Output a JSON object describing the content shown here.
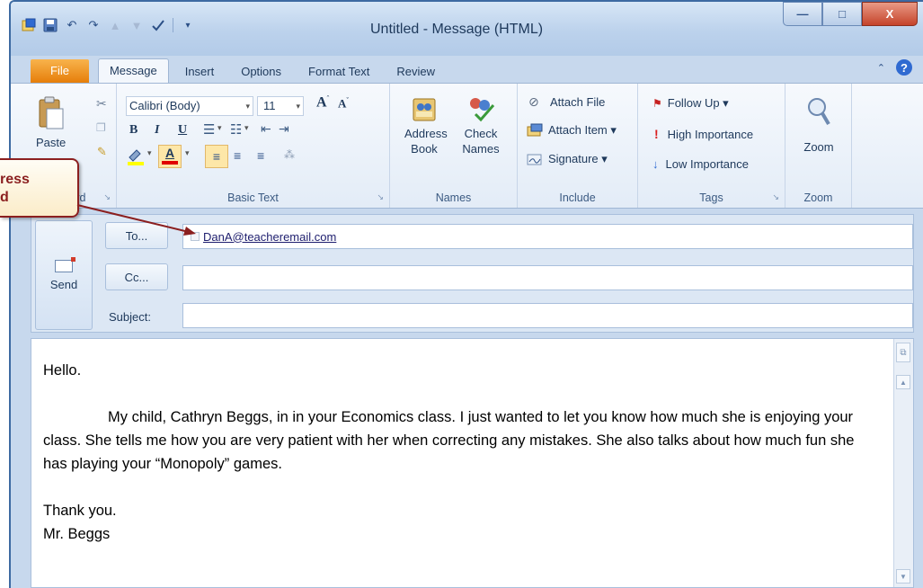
{
  "window": {
    "title": "Untitled - Message (HTML)",
    "buttons": {
      "minimize": "—",
      "maximize": "□",
      "close": "X"
    }
  },
  "qat": [
    "outlook-icon",
    "save-icon",
    "undo-icon",
    "redo-icon",
    "up-icon",
    "down-icon",
    "spelling-icon",
    "customize-icon"
  ],
  "tabs": [
    {
      "label": "File"
    },
    {
      "label": "Message"
    },
    {
      "label": "Insert"
    },
    {
      "label": "Options"
    },
    {
      "label": "Format Text"
    },
    {
      "label": "Review"
    }
  ],
  "ribbon": {
    "clipboard": {
      "label": "Clipboard",
      "paste": "Paste"
    },
    "basic_text": {
      "label": "Basic Text",
      "font": "Calibri (Body)",
      "size": "11",
      "bold": "B",
      "italic": "I",
      "underline": "U"
    },
    "names": {
      "label": "Names",
      "address_book": [
        "Address",
        "Book"
      ],
      "check_names": [
        "Check",
        "Names"
      ]
    },
    "include": {
      "label": "Include",
      "items": [
        "Attach File",
        "Attach Item ▾",
        "Signature ▾"
      ]
    },
    "tags": {
      "label": "Tags",
      "items": [
        "Follow Up ▾",
        "High Importance",
        "Low Importance"
      ]
    },
    "zoom": {
      "label": "Zoom",
      "button": "Zoom"
    }
  },
  "header": {
    "send": "Send",
    "to_button": "To...",
    "cc_button": "Cc...",
    "subject_label": "Subject:",
    "to_value": "DanA@teacheremail.com",
    "cc_value": "",
    "subject_value": ""
  },
  "body": {
    "greeting": "Hello.",
    "paragraph": "My child, Cathryn Beggs, in in your Economics class. I just wanted to let you know how much she is enjoying your class. She tells me how you are very patient with her when correcting any mistakes. She also talks about how much fun she has playing your “Monopoly” games.",
    "closing": "Thank you.",
    "signature": "Mr. Beggs"
  },
  "callout": {
    "line1": "ress",
    "line2": "d"
  },
  "colors": {
    "accent": "#e67e0a",
    "frame": "#c7d8ed",
    "callout_border": "#8b1f1f"
  }
}
